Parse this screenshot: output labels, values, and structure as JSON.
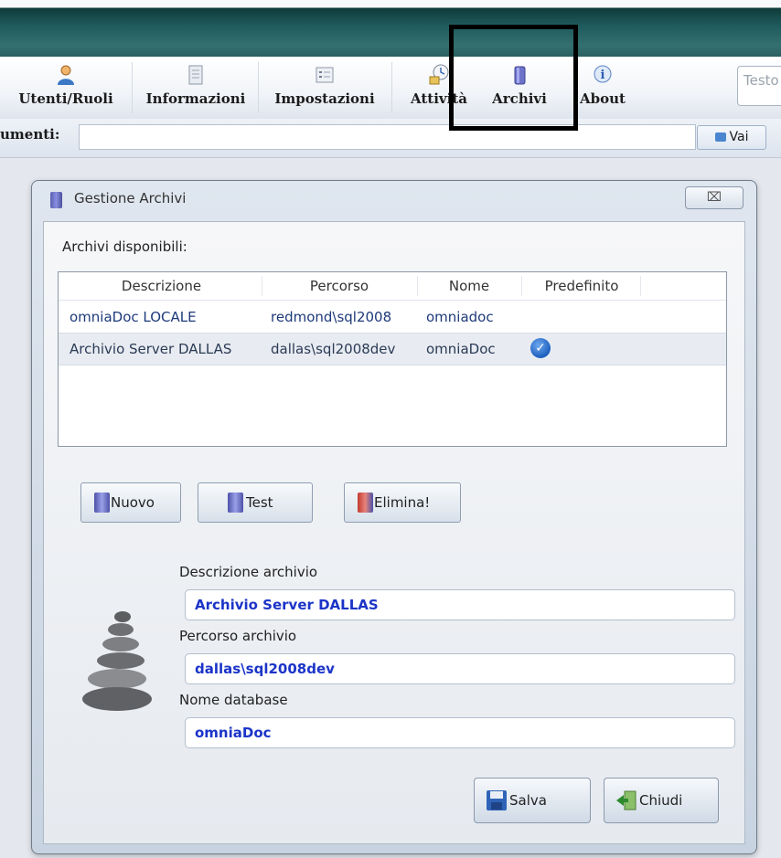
{
  "toolbar": {
    "items": [
      {
        "label": "Utenti/Ruoli",
        "icon": "user-icon"
      },
      {
        "label": "Informazioni",
        "icon": "document-icon"
      },
      {
        "label": "Impostazioni",
        "icon": "settings-list-icon"
      },
      {
        "label": "Attività",
        "icon": "clock-icon"
      },
      {
        "label": "Archivi",
        "icon": "database-icon"
      },
      {
        "label": "About",
        "icon": "info-icon"
      }
    ],
    "search_placeholder": "Testo"
  },
  "address": {
    "label": "umenti:",
    "go_label": "Vai"
  },
  "dialog": {
    "title": "Gestione Archivi",
    "close_label": "⌧",
    "available_label": "Archivi disponibili:",
    "columns": [
      "Descrizione",
      "Percorso",
      "Nome",
      "Predefinito"
    ],
    "rows": [
      {
        "descrizione": "omniaDoc LOCALE",
        "percorso": "redmond\\sql2008",
        "nome": "omniadoc",
        "predefinito": false
      },
      {
        "descrizione": "Archivio Server DALLAS",
        "percorso": "dallas\\sql2008dev",
        "nome": "omniaDoc",
        "predefinito": true
      }
    ],
    "buttons": {
      "nuovo": "Nuovo",
      "test": "Test",
      "elimina": "Elimina!",
      "salva": "Salva",
      "chiudi": "Chiudi"
    },
    "fields": {
      "descrizione_label": "Descrizione archivio",
      "descrizione_value": "Archivio Server DALLAS",
      "percorso_label": "Percorso archivio",
      "percorso_value": "dallas\\sql2008dev",
      "nome_label": "Nome database",
      "nome_value": "omniaDoc"
    }
  },
  "colors": {
    "field_text": "#1b34c8",
    "title_bar": "#1f5a5c",
    "highlight_box": "#000000"
  }
}
